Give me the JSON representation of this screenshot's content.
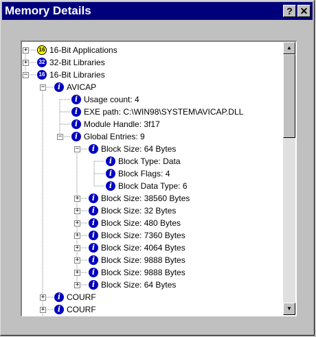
{
  "window": {
    "title": "Memory Details",
    "help_label": "?",
    "close_label": "✕"
  },
  "tree": [
    {
      "label": "16-Bit Applications",
      "icon": "16-bit-app-icon",
      "glyph": "16",
      "kind": "app16",
      "level": 0,
      "expander": "+"
    },
    {
      "label": "32-Bit Libraries",
      "icon": "32-bit-library-icon",
      "glyph": "32",
      "kind": "lib32",
      "level": 0,
      "expander": "+"
    },
    {
      "label": "16-Bit Libraries",
      "icon": "16-bit-library-icon",
      "glyph": "16",
      "kind": "lib16",
      "level": 0,
      "expander": "−"
    },
    {
      "label": "AVICAP",
      "icon": "info-icon",
      "glyph": "i",
      "kind": "info",
      "level": 1,
      "expander": "−"
    },
    {
      "label": "Usage count: 4",
      "icon": "info-icon",
      "glyph": "i",
      "kind": "info",
      "level": 2,
      "expander": ""
    },
    {
      "label": "EXE path: C:\\WIN98\\SYSTEM\\AVICAP.DLL",
      "icon": "info-icon",
      "glyph": "i",
      "kind": "info",
      "level": 2,
      "expander": ""
    },
    {
      "label": "Module Handle: 3f17",
      "icon": "info-icon",
      "glyph": "i",
      "kind": "info",
      "level": 2,
      "expander": ""
    },
    {
      "label": "Global Entries: 9",
      "icon": "info-icon",
      "glyph": "i",
      "kind": "info",
      "level": 2,
      "expander": "−"
    },
    {
      "label": "Block Size: 64 Bytes",
      "icon": "info-icon",
      "glyph": "i",
      "kind": "info",
      "level": 3,
      "expander": "−"
    },
    {
      "label": "Block Type: Data",
      "icon": "info-icon",
      "glyph": "i",
      "kind": "info",
      "level": 4,
      "expander": ""
    },
    {
      "label": "Block Flags: 4",
      "icon": "info-icon",
      "glyph": "i",
      "kind": "info",
      "level": 4,
      "expander": ""
    },
    {
      "label": "Block Data Type: 6",
      "icon": "info-icon",
      "glyph": "i",
      "kind": "info",
      "level": 4,
      "expander": ""
    },
    {
      "label": "Block Size: 38560 Bytes",
      "icon": "info-icon",
      "glyph": "i",
      "kind": "info",
      "level": 3,
      "expander": "+"
    },
    {
      "label": "Block Size: 32 Bytes",
      "icon": "info-icon",
      "glyph": "i",
      "kind": "info",
      "level": 3,
      "expander": "+"
    },
    {
      "label": "Block Size: 480 Bytes",
      "icon": "info-icon",
      "glyph": "i",
      "kind": "info",
      "level": 3,
      "expander": "+"
    },
    {
      "label": "Block Size: 7360 Bytes",
      "icon": "info-icon",
      "glyph": "i",
      "kind": "info",
      "level": 3,
      "expander": "+"
    },
    {
      "label": "Block Size: 4064 Bytes",
      "icon": "info-icon",
      "glyph": "i",
      "kind": "info",
      "level": 3,
      "expander": "+"
    },
    {
      "label": "Block Size: 9888 Bytes",
      "icon": "info-icon",
      "glyph": "i",
      "kind": "info",
      "level": 3,
      "expander": "+"
    },
    {
      "label": "Block Size: 9888 Bytes",
      "icon": "info-icon",
      "glyph": "i",
      "kind": "info",
      "level": 3,
      "expander": "+"
    },
    {
      "label": "Block Size: 64 Bytes",
      "icon": "info-icon",
      "glyph": "i",
      "kind": "info",
      "level": 3,
      "expander": "+"
    },
    {
      "label": "COURF",
      "icon": "info-icon",
      "glyph": "i",
      "kind": "info",
      "level": 1,
      "expander": "+"
    },
    {
      "label": "COURF",
      "icon": "info-icon",
      "glyph": "i",
      "kind": "info",
      "level": 1,
      "expander": "+"
    },
    {
      "label": "",
      "icon": "info-icon",
      "glyph": "i",
      "kind": "info",
      "level": 1,
      "expander": ""
    }
  ],
  "scrollbar": {
    "up_glyph": "▲",
    "down_glyph": "▼"
  }
}
